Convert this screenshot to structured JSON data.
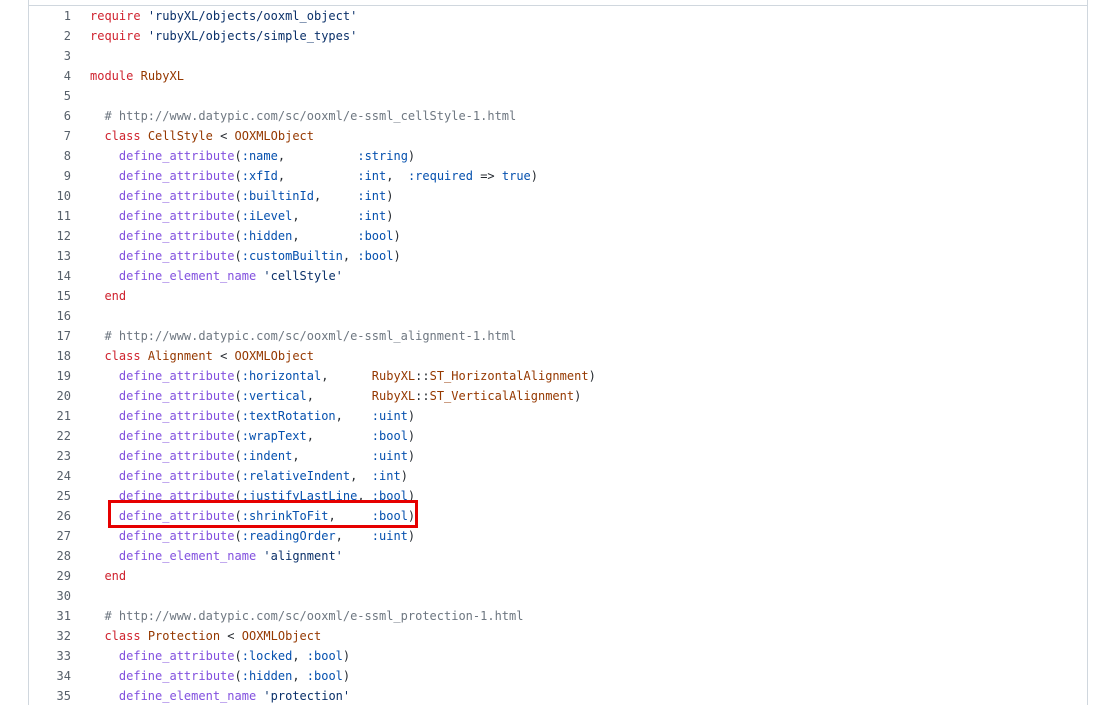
{
  "editor": {
    "highlighted_line": 26,
    "highlight_color": "#e60000",
    "lines": [
      {
        "n": "1",
        "tokens": [
          {
            "t": "require",
            "c": "kw"
          },
          {
            "t": " ",
            "c": "pl"
          },
          {
            "t": "'rubyXL/objects/ooxml_object'",
            "c": "str"
          }
        ]
      },
      {
        "n": "2",
        "tokens": [
          {
            "t": "require",
            "c": "kw"
          },
          {
            "t": " ",
            "c": "pl"
          },
          {
            "t": "'rubyXL/objects/simple_types'",
            "c": "str"
          }
        ]
      },
      {
        "n": "3",
        "tokens": []
      },
      {
        "n": "4",
        "tokens": [
          {
            "t": "module",
            "c": "kw"
          },
          {
            "t": " ",
            "c": "pl"
          },
          {
            "t": "RubyXL",
            "c": "cls"
          }
        ]
      },
      {
        "n": "5",
        "tokens": []
      },
      {
        "n": "6",
        "tokens": [
          {
            "t": "  # http://www.datypic.com/sc/ooxml/e-ssml_cellStyle-1.html",
            "c": "cmt"
          }
        ]
      },
      {
        "n": "7",
        "tokens": [
          {
            "t": "  ",
            "c": "pl"
          },
          {
            "t": "class",
            "c": "kw"
          },
          {
            "t": " ",
            "c": "pl"
          },
          {
            "t": "CellStyle",
            "c": "cls"
          },
          {
            "t": " < ",
            "c": "pl"
          },
          {
            "t": "OOXMLObject",
            "c": "cls"
          }
        ]
      },
      {
        "n": "8",
        "tokens": [
          {
            "t": "    ",
            "c": "pl"
          },
          {
            "t": "define_attribute",
            "c": "fn"
          },
          {
            "t": "(",
            "c": "pl"
          },
          {
            "t": ":name",
            "c": "sym"
          },
          {
            "t": ",          ",
            "c": "pl"
          },
          {
            "t": ":string",
            "c": "sym"
          },
          {
            "t": ")",
            "c": "pl"
          }
        ]
      },
      {
        "n": "9",
        "tokens": [
          {
            "t": "    ",
            "c": "pl"
          },
          {
            "t": "define_attribute",
            "c": "fn"
          },
          {
            "t": "(",
            "c": "pl"
          },
          {
            "t": ":xfId",
            "c": "sym"
          },
          {
            "t": ",          ",
            "c": "pl"
          },
          {
            "t": ":int",
            "c": "sym"
          },
          {
            "t": ",  ",
            "c": "pl"
          },
          {
            "t": ":required",
            "c": "sym"
          },
          {
            "t": " => ",
            "c": "pl"
          },
          {
            "t": "true",
            "c": "sym"
          },
          {
            "t": ")",
            "c": "pl"
          }
        ]
      },
      {
        "n": "10",
        "tokens": [
          {
            "t": "    ",
            "c": "pl"
          },
          {
            "t": "define_attribute",
            "c": "fn"
          },
          {
            "t": "(",
            "c": "pl"
          },
          {
            "t": ":builtinId",
            "c": "sym"
          },
          {
            "t": ",     ",
            "c": "pl"
          },
          {
            "t": ":int",
            "c": "sym"
          },
          {
            "t": ")",
            "c": "pl"
          }
        ]
      },
      {
        "n": "11",
        "tokens": [
          {
            "t": "    ",
            "c": "pl"
          },
          {
            "t": "define_attribute",
            "c": "fn"
          },
          {
            "t": "(",
            "c": "pl"
          },
          {
            "t": ":iLevel",
            "c": "sym"
          },
          {
            "t": ",        ",
            "c": "pl"
          },
          {
            "t": ":int",
            "c": "sym"
          },
          {
            "t": ")",
            "c": "pl"
          }
        ]
      },
      {
        "n": "12",
        "tokens": [
          {
            "t": "    ",
            "c": "pl"
          },
          {
            "t": "define_attribute",
            "c": "fn"
          },
          {
            "t": "(",
            "c": "pl"
          },
          {
            "t": ":hidden",
            "c": "sym"
          },
          {
            "t": ",        ",
            "c": "pl"
          },
          {
            "t": ":bool",
            "c": "sym"
          },
          {
            "t": ")",
            "c": "pl"
          }
        ]
      },
      {
        "n": "13",
        "tokens": [
          {
            "t": "    ",
            "c": "pl"
          },
          {
            "t": "define_attribute",
            "c": "fn"
          },
          {
            "t": "(",
            "c": "pl"
          },
          {
            "t": ":customBuiltin",
            "c": "sym"
          },
          {
            "t": ", ",
            "c": "pl"
          },
          {
            "t": ":bool",
            "c": "sym"
          },
          {
            "t": ")",
            "c": "pl"
          }
        ]
      },
      {
        "n": "14",
        "tokens": [
          {
            "t": "    ",
            "c": "pl"
          },
          {
            "t": "define_element_name",
            "c": "fn"
          },
          {
            "t": " ",
            "c": "pl"
          },
          {
            "t": "'cellStyle'",
            "c": "str"
          }
        ]
      },
      {
        "n": "15",
        "tokens": [
          {
            "t": "  ",
            "c": "pl"
          },
          {
            "t": "end",
            "c": "kw"
          }
        ]
      },
      {
        "n": "16",
        "tokens": []
      },
      {
        "n": "17",
        "tokens": [
          {
            "t": "  # http://www.datypic.com/sc/ooxml/e-ssml_alignment-1.html",
            "c": "cmt"
          }
        ]
      },
      {
        "n": "18",
        "tokens": [
          {
            "t": "  ",
            "c": "pl"
          },
          {
            "t": "class",
            "c": "kw"
          },
          {
            "t": " ",
            "c": "pl"
          },
          {
            "t": "Alignment",
            "c": "cls"
          },
          {
            "t": " < ",
            "c": "pl"
          },
          {
            "t": "OOXMLObject",
            "c": "cls"
          }
        ]
      },
      {
        "n": "19",
        "tokens": [
          {
            "t": "    ",
            "c": "pl"
          },
          {
            "t": "define_attribute",
            "c": "fn"
          },
          {
            "t": "(",
            "c": "pl"
          },
          {
            "t": ":horizontal",
            "c": "sym"
          },
          {
            "t": ",      ",
            "c": "pl"
          },
          {
            "t": "RubyXL",
            "c": "cls"
          },
          {
            "t": "::",
            "c": "pl"
          },
          {
            "t": "ST_HorizontalAlignment",
            "c": "cls"
          },
          {
            "t": ")",
            "c": "pl"
          }
        ]
      },
      {
        "n": "20",
        "tokens": [
          {
            "t": "    ",
            "c": "pl"
          },
          {
            "t": "define_attribute",
            "c": "fn"
          },
          {
            "t": "(",
            "c": "pl"
          },
          {
            "t": ":vertical",
            "c": "sym"
          },
          {
            "t": ",        ",
            "c": "pl"
          },
          {
            "t": "RubyXL",
            "c": "cls"
          },
          {
            "t": "::",
            "c": "pl"
          },
          {
            "t": "ST_VerticalAlignment",
            "c": "cls"
          },
          {
            "t": ")",
            "c": "pl"
          }
        ]
      },
      {
        "n": "21",
        "tokens": [
          {
            "t": "    ",
            "c": "pl"
          },
          {
            "t": "define_attribute",
            "c": "fn"
          },
          {
            "t": "(",
            "c": "pl"
          },
          {
            "t": ":textRotation",
            "c": "sym"
          },
          {
            "t": ",    ",
            "c": "pl"
          },
          {
            "t": ":uint",
            "c": "sym"
          },
          {
            "t": ")",
            "c": "pl"
          }
        ]
      },
      {
        "n": "22",
        "tokens": [
          {
            "t": "    ",
            "c": "pl"
          },
          {
            "t": "define_attribute",
            "c": "fn"
          },
          {
            "t": "(",
            "c": "pl"
          },
          {
            "t": ":wrapText",
            "c": "sym"
          },
          {
            "t": ",        ",
            "c": "pl"
          },
          {
            "t": ":bool",
            "c": "sym"
          },
          {
            "t": ")",
            "c": "pl"
          }
        ]
      },
      {
        "n": "23",
        "tokens": [
          {
            "t": "    ",
            "c": "pl"
          },
          {
            "t": "define_attribute",
            "c": "fn"
          },
          {
            "t": "(",
            "c": "pl"
          },
          {
            "t": ":indent",
            "c": "sym"
          },
          {
            "t": ",          ",
            "c": "pl"
          },
          {
            "t": ":uint",
            "c": "sym"
          },
          {
            "t": ")",
            "c": "pl"
          }
        ]
      },
      {
        "n": "24",
        "tokens": [
          {
            "t": "    ",
            "c": "pl"
          },
          {
            "t": "define_attribute",
            "c": "fn"
          },
          {
            "t": "(",
            "c": "pl"
          },
          {
            "t": ":relativeIndent",
            "c": "sym"
          },
          {
            "t": ",  ",
            "c": "pl"
          },
          {
            "t": ":int",
            "c": "sym"
          },
          {
            "t": ")",
            "c": "pl"
          }
        ]
      },
      {
        "n": "25",
        "tokens": [
          {
            "t": "    ",
            "c": "pl"
          },
          {
            "t": "define_attribute",
            "c": "fn"
          },
          {
            "t": "(",
            "c": "pl"
          },
          {
            "t": ":justifyLastLine",
            "c": "sym"
          },
          {
            "t": ", ",
            "c": "pl"
          },
          {
            "t": ":bool",
            "c": "sym"
          },
          {
            "t": ")",
            "c": "pl"
          }
        ]
      },
      {
        "n": "26",
        "tokens": [
          {
            "t": "    ",
            "c": "pl"
          },
          {
            "t": "define_attribute",
            "c": "fn"
          },
          {
            "t": "(",
            "c": "pl"
          },
          {
            "t": ":shrinkToFit",
            "c": "sym"
          },
          {
            "t": ",     ",
            "c": "pl"
          },
          {
            "t": ":bool",
            "c": "sym"
          },
          {
            "t": ")",
            "c": "pl"
          }
        ]
      },
      {
        "n": "27",
        "tokens": [
          {
            "t": "    ",
            "c": "pl"
          },
          {
            "t": "define_attribute",
            "c": "fn"
          },
          {
            "t": "(",
            "c": "pl"
          },
          {
            "t": ":readingOrder",
            "c": "sym"
          },
          {
            "t": ",    ",
            "c": "pl"
          },
          {
            "t": ":uint",
            "c": "sym"
          },
          {
            "t": ")",
            "c": "pl"
          }
        ]
      },
      {
        "n": "28",
        "tokens": [
          {
            "t": "    ",
            "c": "pl"
          },
          {
            "t": "define_element_name",
            "c": "fn"
          },
          {
            "t": " ",
            "c": "pl"
          },
          {
            "t": "'alignment'",
            "c": "str"
          }
        ]
      },
      {
        "n": "29",
        "tokens": [
          {
            "t": "  ",
            "c": "pl"
          },
          {
            "t": "end",
            "c": "kw"
          }
        ]
      },
      {
        "n": "30",
        "tokens": []
      },
      {
        "n": "31",
        "tokens": [
          {
            "t": "  # http://www.datypic.com/sc/ooxml/e-ssml_protection-1.html",
            "c": "cmt"
          }
        ]
      },
      {
        "n": "32",
        "tokens": [
          {
            "t": "  ",
            "c": "pl"
          },
          {
            "t": "class",
            "c": "kw"
          },
          {
            "t": " ",
            "c": "pl"
          },
          {
            "t": "Protection",
            "c": "cls"
          },
          {
            "t": " < ",
            "c": "pl"
          },
          {
            "t": "OOXMLObject",
            "c": "cls"
          }
        ]
      },
      {
        "n": "33",
        "tokens": [
          {
            "t": "    ",
            "c": "pl"
          },
          {
            "t": "define_attribute",
            "c": "fn"
          },
          {
            "t": "(",
            "c": "pl"
          },
          {
            "t": ":locked",
            "c": "sym"
          },
          {
            "t": ", ",
            "c": "pl"
          },
          {
            "t": ":bool",
            "c": "sym"
          },
          {
            "t": ")",
            "c": "pl"
          }
        ]
      },
      {
        "n": "34",
        "tokens": [
          {
            "t": "    ",
            "c": "pl"
          },
          {
            "t": "define_attribute",
            "c": "fn"
          },
          {
            "t": "(",
            "c": "pl"
          },
          {
            "t": ":hidden",
            "c": "sym"
          },
          {
            "t": ", ",
            "c": "pl"
          },
          {
            "t": ":bool",
            "c": "sym"
          },
          {
            "t": ")",
            "c": "pl"
          }
        ]
      },
      {
        "n": "35",
        "tokens": [
          {
            "t": "    ",
            "c": "pl"
          },
          {
            "t": "define_element_name",
            "c": "fn"
          },
          {
            "t": " ",
            "c": "pl"
          },
          {
            "t": "'protection'",
            "c": "str"
          }
        ]
      }
    ]
  }
}
